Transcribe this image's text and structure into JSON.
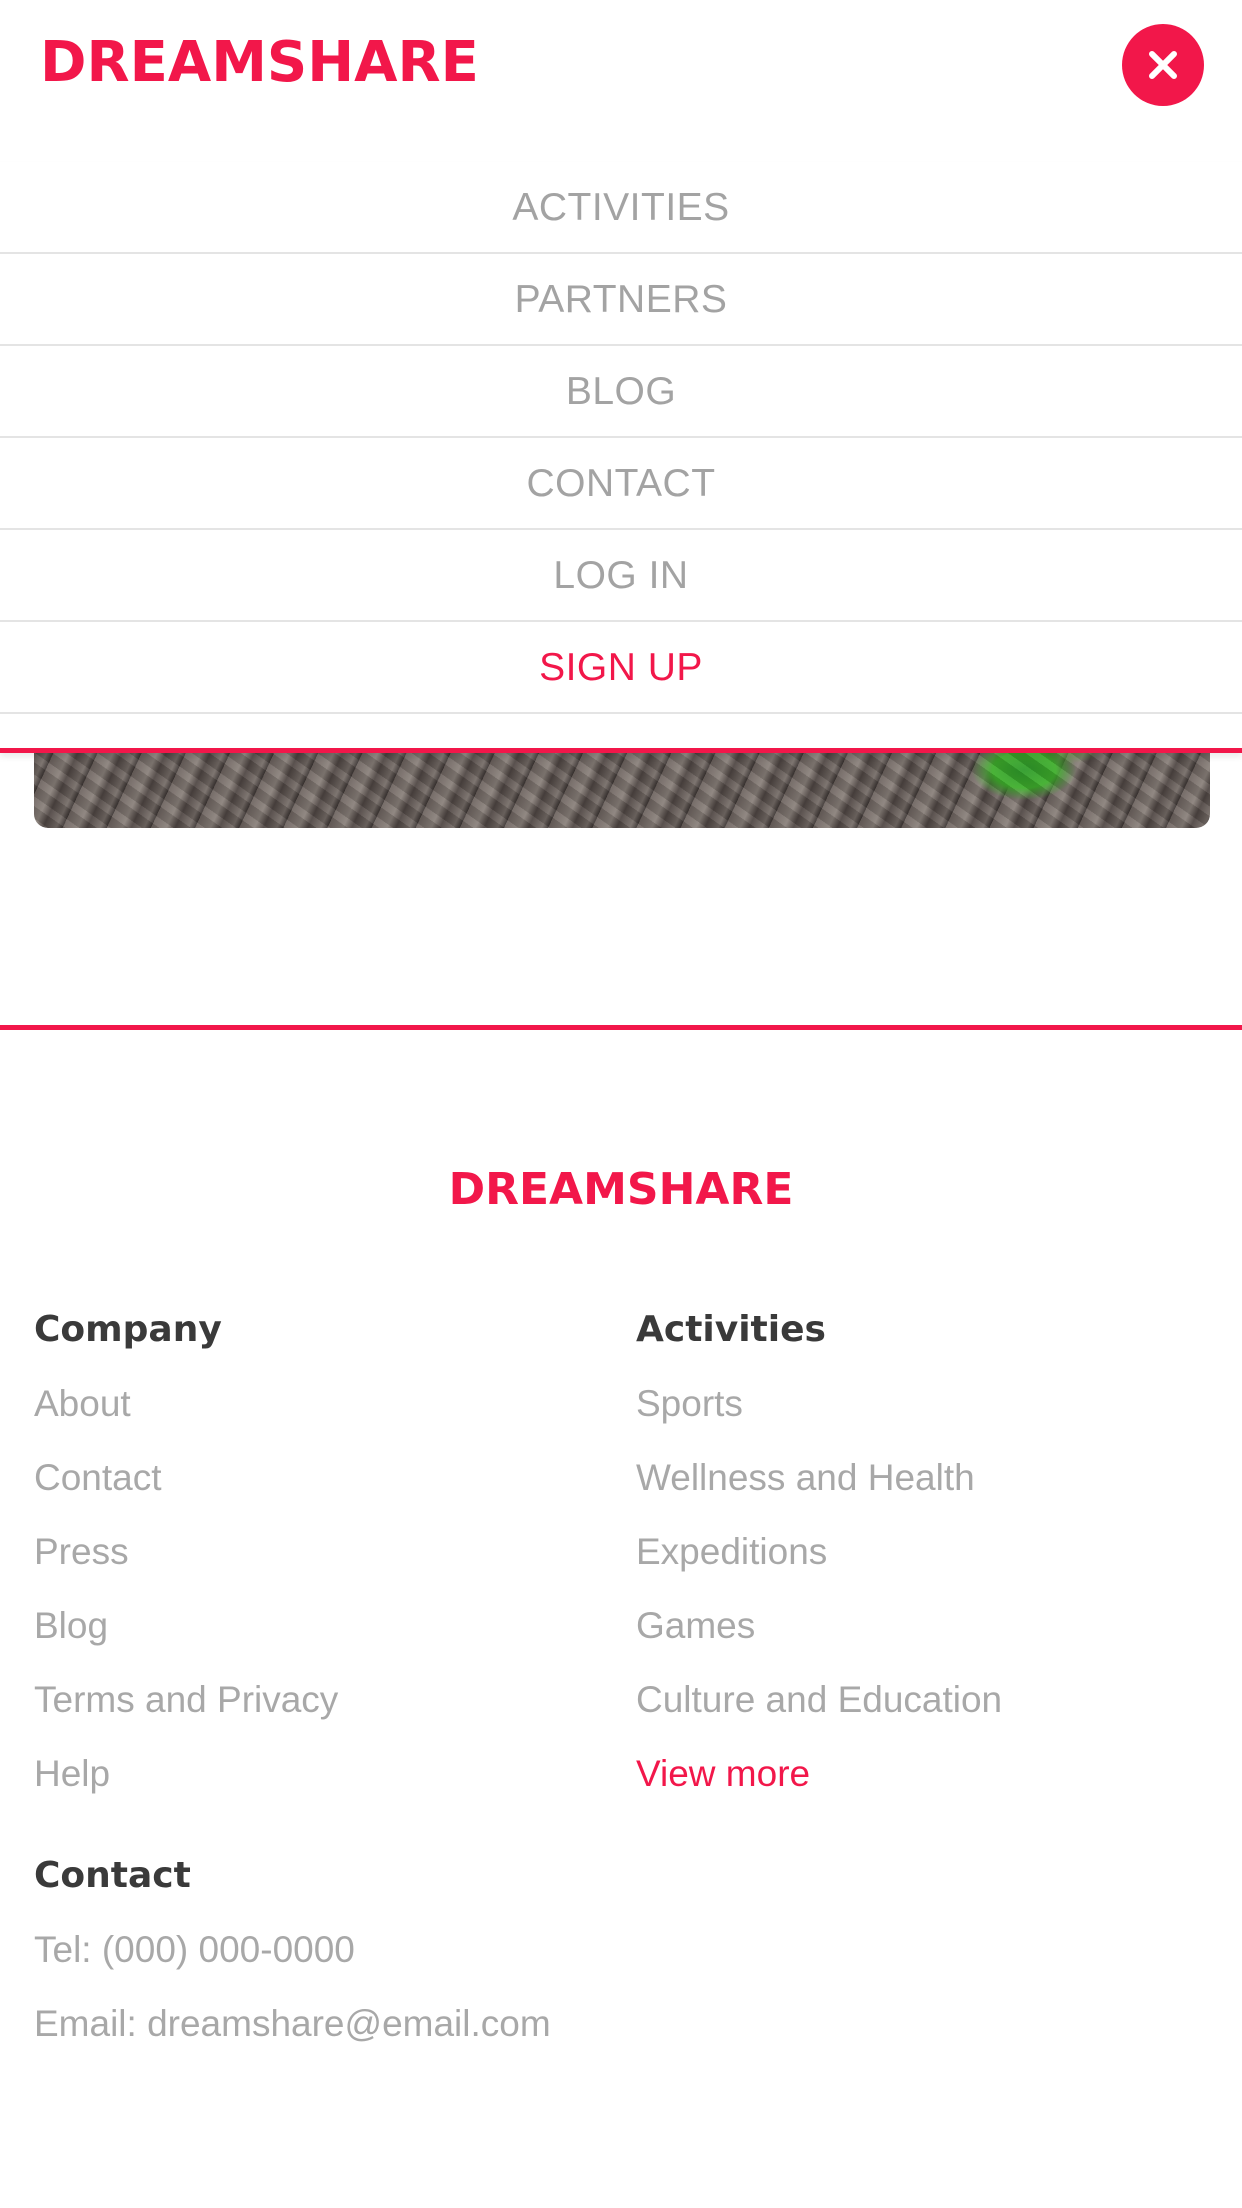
{
  "header": {
    "logo": "DREAMSHARE",
    "close_icon": "close-icon"
  },
  "menu": {
    "items": [
      {
        "label": "ACTIVITIES"
      },
      {
        "label": "PARTNERS"
      },
      {
        "label": "BLOG"
      },
      {
        "label": "CONTACT"
      },
      {
        "label": "LOG IN"
      },
      {
        "label": "SIGN UP"
      }
    ]
  },
  "footer": {
    "logo": "DREAMSHARE",
    "company": {
      "title": "Company",
      "links": [
        "About",
        "Contact",
        "Press",
        "Blog",
        "Terms and Privacy",
        "Help"
      ]
    },
    "activities": {
      "title": "Activities",
      "links": [
        "Sports",
        "Wellness and Health",
        "Expeditions",
        "Games",
        "Culture and Education"
      ],
      "view_more": "View more"
    },
    "contact": {
      "title": "Contact",
      "tel": "Tel: (000) 000-0000",
      "email": "Email: dreamshare@email.com"
    }
  },
  "colors": {
    "accent": "#f2174a",
    "muted_text": "#a3a3a3",
    "heading_text": "#3a3a3a",
    "divider": "#e4e4e4"
  }
}
